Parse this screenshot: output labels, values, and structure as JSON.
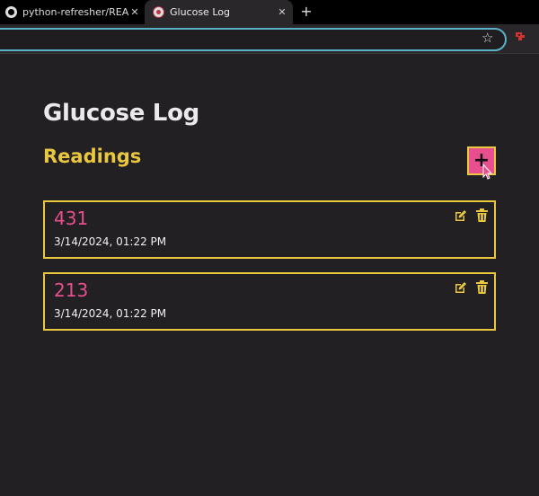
{
  "browser": {
    "tabs": [
      {
        "label": "python-refresher/README.m",
        "favicon": "github-icon",
        "active": false
      },
      {
        "label": "Glucose Log",
        "favicon": "glucose-log-icon",
        "active": true
      }
    ],
    "close_glyph": "✕",
    "new_tab_glyph": "+",
    "address": {
      "value": "",
      "placeholder": ""
    },
    "bookmark_glyph": "☆",
    "accent_color": "#5ab2c6"
  },
  "app": {
    "title": "Glucose Log",
    "section_title": "Readings",
    "add_button_label": "+",
    "colors": {
      "background": "#222022",
      "accent_yellow": "#e9c73f",
      "accent_pink": "#e84f8e",
      "title_text": "#ece9ec"
    },
    "readings": [
      {
        "value": "431",
        "timestamp": "3/14/2024, 01:22 PM"
      },
      {
        "value": "213",
        "timestamp": "3/14/2024, 01:22 PM"
      }
    ]
  }
}
